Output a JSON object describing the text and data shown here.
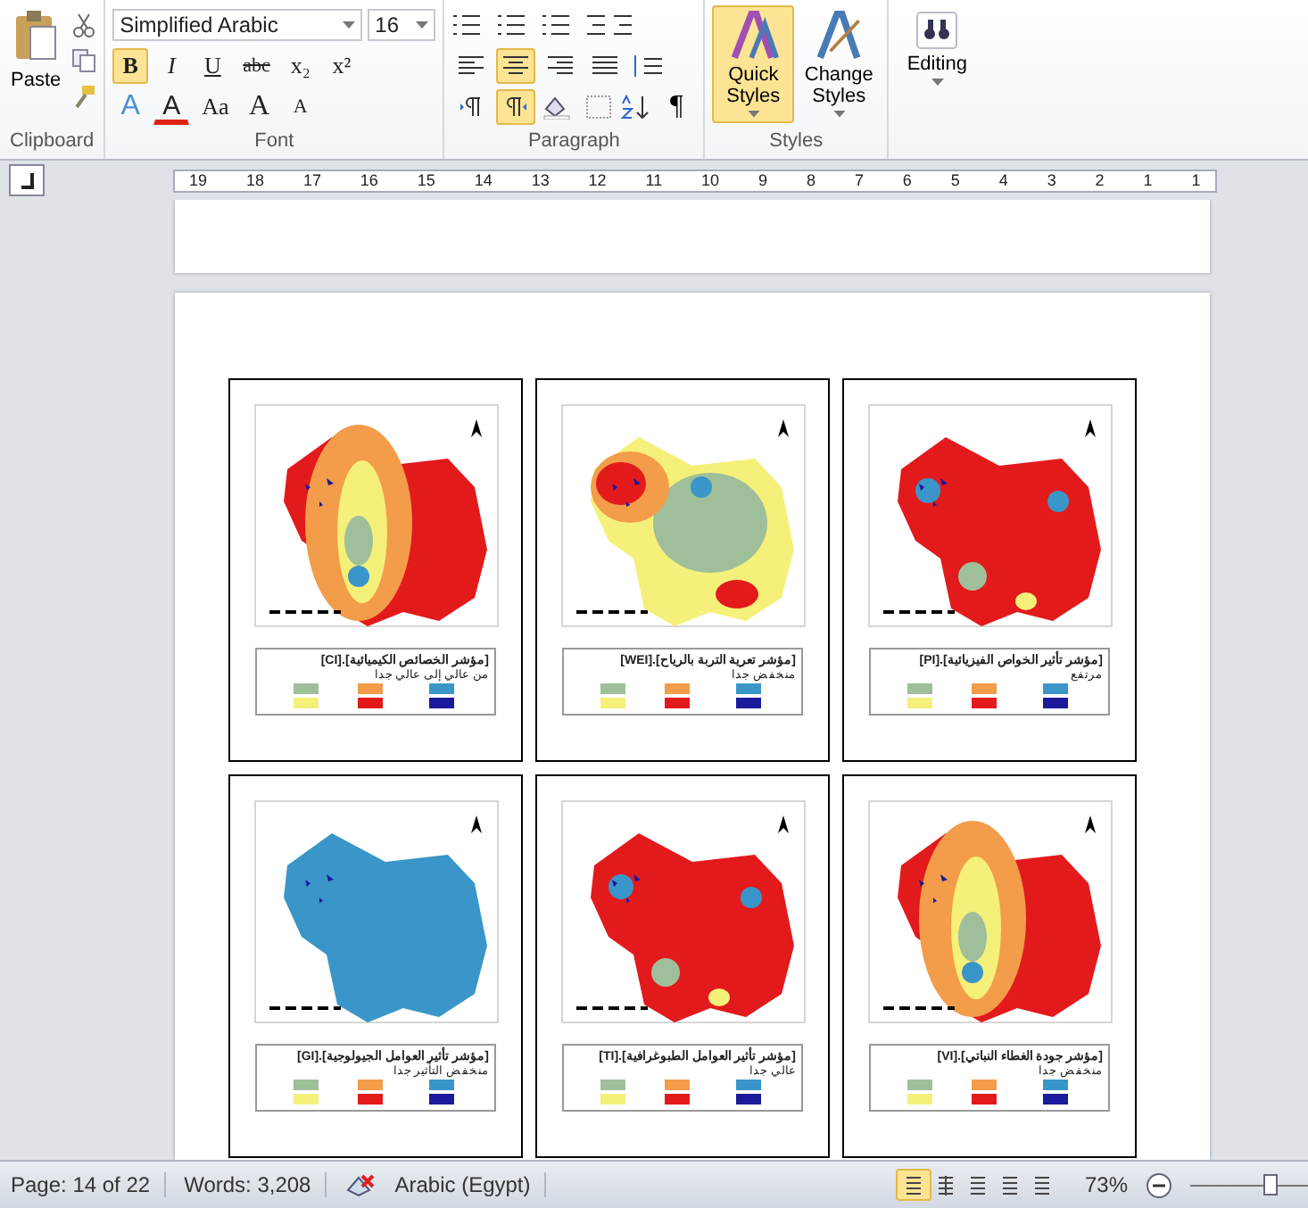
{
  "ribbon": {
    "clipboard": {
      "paste": "Paste",
      "label": "Clipboard"
    },
    "font": {
      "name": "Simplified Arabic",
      "size": "16",
      "label": "Font",
      "row1": [
        {
          "label": "x²",
          "kind": "plain",
          "selected": false
        },
        {
          "label": "x₂",
          "kind": "plain",
          "selected": false
        },
        {
          "label": "abc",
          "kind": "strike",
          "selected": false
        },
        {
          "label": "U",
          "kind": "underline",
          "selected": false
        },
        {
          "label": "I",
          "kind": "italic",
          "selected": false
        },
        {
          "label": "B",
          "kind": "bold",
          "selected": true
        }
      ],
      "row2": [
        {
          "label": "A",
          "kind": "shrink",
          "selected": false
        },
        {
          "label": "A",
          "kind": "grow",
          "selected": false
        },
        {
          "label": "Aa",
          "kind": "plain",
          "selected": false
        },
        {
          "label": "A",
          "kind": "color",
          "selected": false
        },
        {
          "label": "A",
          "kind": "effect",
          "selected": false
        }
      ]
    },
    "paragraph": {
      "label": "Paragraph",
      "align": [
        {
          "kind": "left",
          "selected": false
        },
        {
          "kind": "center",
          "selected": true
        },
        {
          "kind": "right",
          "selected": false
        },
        {
          "kind": "justify",
          "selected": false
        }
      ],
      "direction": [
        {
          "kind": "ltr",
          "selected": false
        },
        {
          "kind": "rtl",
          "selected": true
        }
      ],
      "pilcrow": "¶"
    },
    "styles": {
      "label": "Styles",
      "buttons": [
        {
          "label": "Change Styles",
          "selected": false
        },
        {
          "label": "Quick Styles",
          "selected": true
        }
      ]
    },
    "editing": {
      "label": "Editing"
    }
  },
  "ruler": {
    "numbers": [
      "1",
      "1",
      "2",
      "3",
      "4",
      "5",
      "6",
      "7",
      "8",
      "9",
      "10",
      "11",
      "12",
      "13",
      "14",
      "15",
      "16",
      "17",
      "18",
      "19"
    ]
  },
  "maps": [
    {
      "title": "[مؤشر تأثير الخواص الفيزيائية].[PI]",
      "subtitle": "مرتفع",
      "color": "#e31a1c",
      "kind": "spotted"
    },
    {
      "title": "[مؤشر تعرية التربة بالرياح].[WEI]",
      "subtitle": "منخفض جدا",
      "color": "#f5f07a",
      "kind": "patchy"
    },
    {
      "title": "[مؤشر الخصائص الكيميائية].[CI]",
      "subtitle": "من عالي إلى عالي جدا",
      "color": "#e31a1c",
      "kind": "zoned"
    },
    {
      "title": "[مؤشر جودة الغطاء النباتي].[VI]",
      "subtitle": "منخفض جدا",
      "color": "#e31a1c",
      "kind": "zoned"
    },
    {
      "title": "[مؤشر تأثير العوامل الطبوغرافية].[TI]",
      "subtitle": "عالي جدا",
      "color": "#e31a1c",
      "kind": "spotted"
    },
    {
      "title": "[مؤشر تأثير العوامل الجيولوجية].[GI]",
      "subtitle": "منخفض التأثير جدا",
      "color": "#3a96c8",
      "kind": "uniform"
    }
  ],
  "status_bar": {
    "page": "Page: 14 of 22",
    "words": "Words: 3,208",
    "language": "Arabic (Egypt)",
    "views": [
      {
        "kind": "print",
        "selected": true
      },
      {
        "kind": "reading",
        "selected": false
      },
      {
        "kind": "web",
        "selected": false
      },
      {
        "kind": "outline",
        "selected": false
      },
      {
        "kind": "draft",
        "selected": false
      }
    ],
    "zoom": "73%",
    "zoom_slider": {
      "level": 0.45
    }
  }
}
